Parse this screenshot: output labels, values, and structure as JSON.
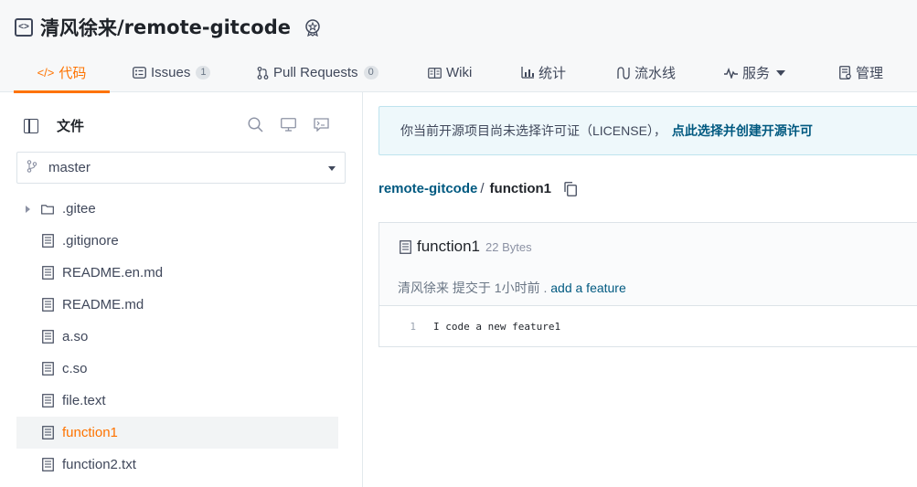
{
  "repo": {
    "owner": "清风徐来",
    "separator": "/",
    "name": "remote-gitcode"
  },
  "tabs": [
    {
      "label": "代码",
      "icon": "code-icon",
      "active": true
    },
    {
      "label": "Issues",
      "count": "1",
      "icon": "issues-icon"
    },
    {
      "label": "Pull Requests",
      "count": "0",
      "icon": "pull-request-icon"
    },
    {
      "label": "Wiki",
      "icon": "wiki-icon"
    },
    {
      "label": "统计",
      "icon": "stats-icon"
    },
    {
      "label": "流水线",
      "icon": "pipeline-icon"
    },
    {
      "label": "服务",
      "icon": "service-icon",
      "dropdown": true
    },
    {
      "label": "管理",
      "icon": "manage-icon"
    }
  ],
  "sidebar": {
    "title": "文件",
    "branch": "master",
    "tools": [
      "search-icon",
      "monitor-icon",
      "terminal-icon"
    ],
    "files": [
      {
        "name": ".gitee",
        "type": "folder"
      },
      {
        "name": ".gitignore",
        "type": "file"
      },
      {
        "name": "README.en.md",
        "type": "file"
      },
      {
        "name": "README.md",
        "type": "file"
      },
      {
        "name": "a.so",
        "type": "file"
      },
      {
        "name": "c.so",
        "type": "file"
      },
      {
        "name": "file.text",
        "type": "file"
      },
      {
        "name": "function1",
        "type": "file",
        "selected": true
      },
      {
        "name": "function2.txt",
        "type": "file"
      }
    ]
  },
  "notice": {
    "text": "你当前开源项目尚未选择许可证（LICENSE），",
    "link": "点此选择并创建开源许可"
  },
  "breadcrumb": {
    "repo": "remote-gitcode",
    "slash": "/",
    "file": "function1"
  },
  "file_view": {
    "name": "function1",
    "size": "22 Bytes",
    "commit_meta": "清风徐来 提交于 1小时前 .",
    "commit_message": "add a feature",
    "lines": [
      {
        "no": "1",
        "code": "I code a new feature1"
      }
    ]
  },
  "colors": {
    "accent": "#fe7300",
    "link": "#005980",
    "notice_bg": "#eef8fb"
  }
}
